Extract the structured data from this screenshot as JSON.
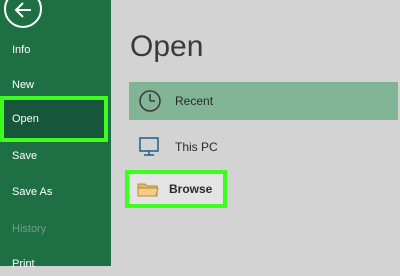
{
  "sidebar": {
    "back_icon": "back-arrow-icon",
    "items": [
      {
        "label": "Info"
      },
      {
        "label": "New"
      },
      {
        "label": "Open"
      },
      {
        "label": "Save"
      },
      {
        "label": "Save As"
      },
      {
        "label": "History"
      },
      {
        "label": "Print"
      }
    ],
    "active_item": "Open",
    "background": "#1f6f45",
    "highlight_color": "#3dff1f"
  },
  "main": {
    "title": "Open",
    "locations": [
      {
        "label": "Recent",
        "icon": "clock-icon"
      },
      {
        "label": "This PC",
        "icon": "computer-icon"
      },
      {
        "label": "Browse",
        "icon": "folder-icon"
      }
    ],
    "selected_color": "#82b595"
  }
}
